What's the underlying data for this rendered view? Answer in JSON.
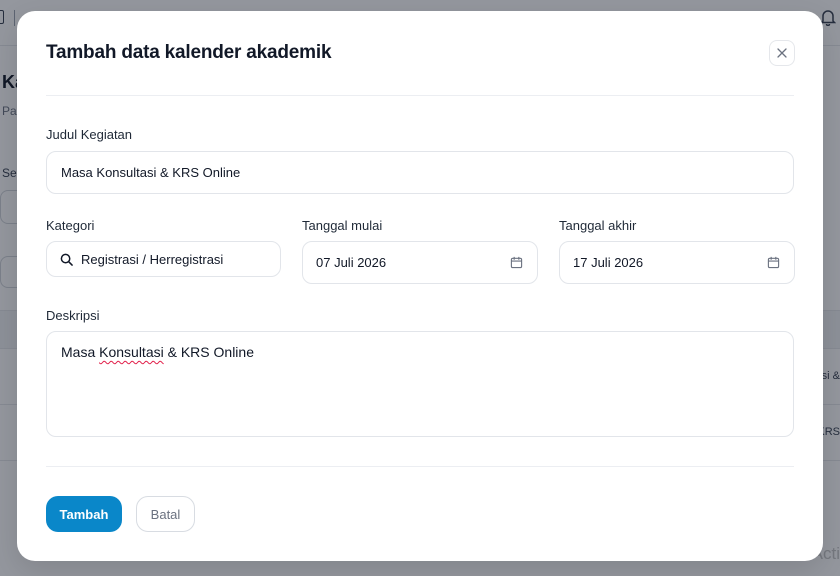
{
  "background": {
    "title": "Ka",
    "subtitle": "Pa",
    "label": "Se",
    "row1_text": "si &",
    "row2_text": "KRS",
    "watermark": "Acti"
  },
  "modal": {
    "title": "Tambah data kalender akademik",
    "close_icon": "close-icon",
    "fields": {
      "judul": {
        "label": "Judul Kegiatan",
        "value": "Masa Konsultasi & KRS Online"
      },
      "kategori": {
        "label": "Kategori",
        "value": "Registrasi / Herregistrasi",
        "icon": "search-icon"
      },
      "tanggal_mulai": {
        "label": "Tanggal mulai",
        "value": "07 Juli 2026",
        "icon": "calendar-icon"
      },
      "tanggal_akhir": {
        "label": "Tanggal akhir",
        "value": "17 Juli 2026",
        "icon": "calendar-icon"
      },
      "deskripsi": {
        "label": "Deskripsi",
        "value_before": "Masa ",
        "value_misspelled": "Konsultasi",
        "value_after": " & KRS Online"
      }
    },
    "actions": {
      "submit_label": "Tambah",
      "cancel_label": "Batal"
    }
  },
  "colors": {
    "primary": "#0a87c9",
    "overlay": "#111827",
    "border": "#e2e5ea",
    "spellcheck": "#e11d48"
  }
}
